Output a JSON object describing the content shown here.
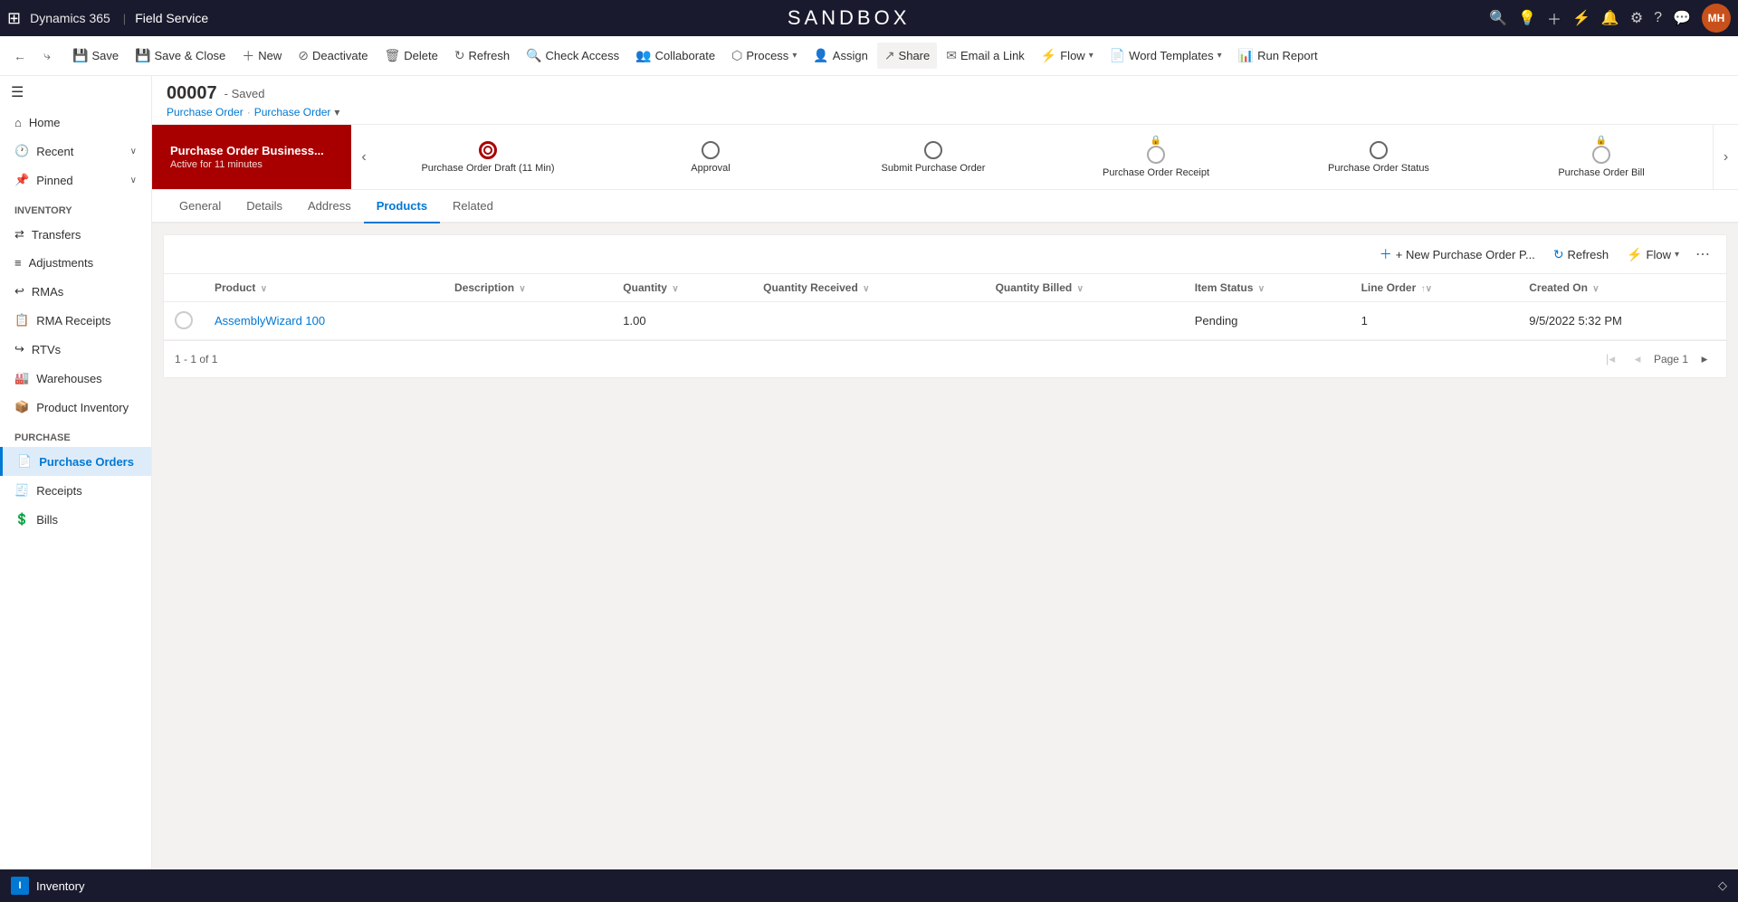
{
  "app": {
    "brand": "Dynamics 365",
    "separator": "|",
    "module": "Field Service",
    "sandbox_title": "SANDBOX"
  },
  "topnav": {
    "icons": [
      "search",
      "lightbulb",
      "plus",
      "filter",
      "bell",
      "settings",
      "help",
      "chat"
    ],
    "avatar_initials": "MH",
    "avatar_bg": "#c8511b"
  },
  "command_bar": {
    "back_btn": "←",
    "forward_btn": "⤷",
    "save": "Save",
    "save_close": "Save & Close",
    "new": "New",
    "deactivate": "Deactivate",
    "delete": "Delete",
    "refresh": "Refresh",
    "check_access": "Check Access",
    "collaborate": "Collaborate",
    "process": "Process",
    "assign": "Assign",
    "share": "Share",
    "email_a_link": "Email a Link",
    "flow": "Flow",
    "word_templates": "Word Templates",
    "run_report": "Run Report"
  },
  "record": {
    "number": "00007",
    "status": "- Saved",
    "breadcrumb1": "Purchase Order",
    "breadcrumb_sep": "·",
    "breadcrumb2": "Purchase Order",
    "breadcrumb_dropdown": "▾"
  },
  "bpf": {
    "active_stage_name": "Purchase Order Business...",
    "active_stage_sub": "Active for 11 minutes",
    "steps": [
      {
        "label": "Purchase Order Draft  (11 Min)",
        "active": true,
        "locked": false
      },
      {
        "label": "Approval",
        "active": false,
        "locked": false
      },
      {
        "label": "Submit Purchase Order",
        "active": false,
        "locked": false
      },
      {
        "label": "Purchase Order Receipt",
        "active": false,
        "locked": true
      },
      {
        "label": "Purchase Order Status",
        "active": false,
        "locked": false
      },
      {
        "label": "Purchase Order Bill",
        "active": false,
        "locked": true
      }
    ]
  },
  "tabs": [
    {
      "id": "general",
      "label": "General"
    },
    {
      "id": "details",
      "label": "Details"
    },
    {
      "id": "address",
      "label": "Address"
    },
    {
      "id": "products",
      "label": "Products",
      "active": true
    },
    {
      "id": "related",
      "label": "Related"
    }
  ],
  "grid": {
    "new_btn": "+ New Purchase Order P...",
    "refresh_btn": "Refresh",
    "flow_btn": "Flow",
    "more_btn": "⋯",
    "columns": [
      {
        "id": "product",
        "label": "Product",
        "sortable": true
      },
      {
        "id": "description",
        "label": "Description",
        "sortable": true
      },
      {
        "id": "quantity",
        "label": "Quantity",
        "sortable": true
      },
      {
        "id": "qty_received",
        "label": "Quantity Received",
        "sortable": true
      },
      {
        "id": "qty_billed",
        "label": "Quantity Billed",
        "sortable": true
      },
      {
        "id": "item_status",
        "label": "Item Status",
        "sortable": true
      },
      {
        "id": "line_order",
        "label": "Line Order",
        "sortable": true
      },
      {
        "id": "created_on",
        "label": "Created On",
        "sortable": true
      }
    ],
    "rows": [
      {
        "product": "AssemblyWizard 100",
        "description": "",
        "quantity": "1.00",
        "qty_received": "",
        "qty_billed": "",
        "item_status": "Pending",
        "line_order": "1",
        "created_on": "9/5/2022 5:32 PM"
      }
    ],
    "pagination_info": "1 - 1 of 1",
    "page_label": "Page 1"
  },
  "sidebar": {
    "hamburger": "☰",
    "top_items": [
      {
        "id": "home",
        "label": "Home",
        "icon": "⌂"
      },
      {
        "id": "recent",
        "label": "Recent",
        "icon": "🕐",
        "has_chevron": true
      },
      {
        "id": "pinned",
        "label": "Pinned",
        "icon": "📌",
        "has_chevron": true
      }
    ],
    "groups": [
      {
        "label": "Inventory",
        "items": [
          {
            "id": "transfers",
            "label": "Transfers",
            "icon": "⇄"
          },
          {
            "id": "adjustments",
            "label": "Adjustments",
            "icon": "≡"
          },
          {
            "id": "rmas",
            "label": "RMAs",
            "icon": "↩"
          },
          {
            "id": "rma-receipts",
            "label": "RMA Receipts",
            "icon": "📋"
          },
          {
            "id": "rtvs",
            "label": "RTVs",
            "icon": "↪"
          },
          {
            "id": "warehouses",
            "label": "Warehouses",
            "icon": "🏭"
          },
          {
            "id": "product-inventory",
            "label": "Product Inventory",
            "icon": "📦"
          }
        ]
      },
      {
        "label": "Purchase",
        "items": [
          {
            "id": "purchase-orders",
            "label": "Purchase Orders",
            "icon": "📄",
            "active": true
          },
          {
            "id": "receipts",
            "label": "Receipts",
            "icon": "🧾"
          },
          {
            "id": "bills",
            "label": "Bills",
            "icon": "💲"
          }
        ]
      }
    ]
  },
  "bottom_bar": {
    "icon_label": "I",
    "label": "Inventory",
    "diamond": "◇"
  }
}
